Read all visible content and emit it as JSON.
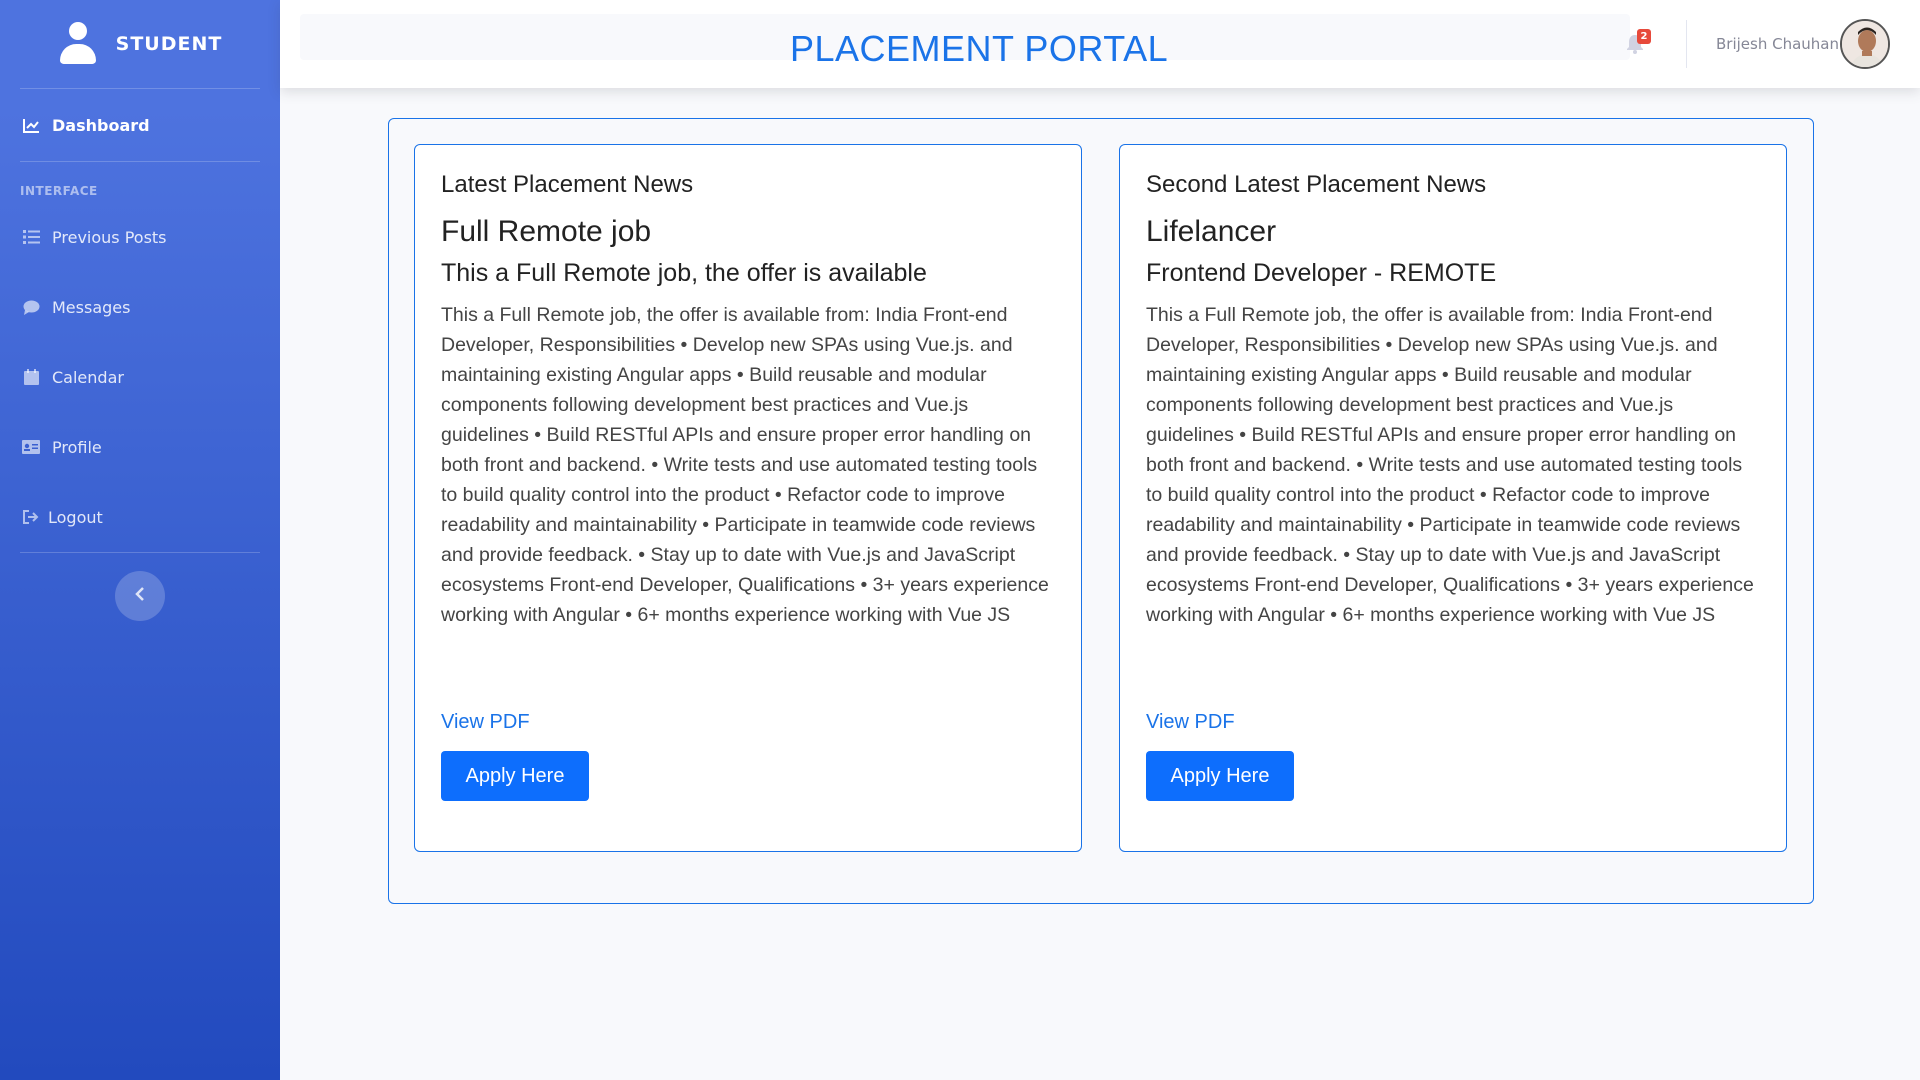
{
  "sidebar": {
    "brand": "STUDENT",
    "heading": "INTERFACE",
    "items": [
      {
        "label": "Dashboard",
        "icon": "chart-line-icon"
      },
      {
        "label": "Previous Posts",
        "icon": "list-icon"
      },
      {
        "label": "Messages",
        "icon": "comment-icon"
      },
      {
        "label": "Calendar",
        "icon": "calendar-icon"
      },
      {
        "label": "Profile",
        "icon": "id-card-icon"
      },
      {
        "label": "Logout",
        "icon": "sign-out-icon"
      }
    ]
  },
  "topbar": {
    "title": "PLACEMENT PORTAL",
    "notification_count": "2",
    "user_name": "Brijesh Chauhan"
  },
  "cards": [
    {
      "section_title": "Latest Placement News",
      "job_title": "Full Remote job",
      "job_subtitle": "This a Full Remote job, the offer is available",
      "description": "This a Full Remote job, the offer is available from: India Front-end Developer, Responsibilities • Develop new SPAs using Vue.js. and maintaining existing Angular apps • Build reusable and modular components following development best practices and Vue.js guidelines • Build RESTful APIs and ensure proper error handling on both front and backend. • Write tests and use automated testing tools to build quality control into the product • Refactor code to improve readability and maintainability • Participate in teamwide code reviews and provide feedback. • Stay up to date with Vue.js and JavaScript ecosystems Front-end Developer, Qualifications • 3+ years experience working with Angular • 6+ months experience working with Vue JS",
      "pdf_link": "View PDF",
      "apply_label": "Apply Here"
    },
    {
      "section_title": "Second Latest Placement News",
      "job_title": "Lifelancer",
      "job_subtitle": "Frontend Developer - REMOTE",
      "description": "This a Full Remote job, the offer is available from: India Front-end Developer, Responsibilities • Develop new SPAs using Vue.js. and maintaining existing Angular apps • Build reusable and modular components following development best practices and Vue.js guidelines • Build RESTful APIs and ensure proper error handling on both front and backend. • Write tests and use automated testing tools to build quality control into the product • Refactor code to improve readability and maintainability • Participate in teamwide code reviews and provide feedback. • Stay up to date with Vue.js and JavaScript ecosystems Front-end Developer, Qualifications • 3+ years experience working with Angular • 6+ months experience working with Vue JS",
      "pdf_link": "View PDF",
      "apply_label": "Apply Here"
    }
  ],
  "colors": {
    "sidebar_top": "#4e73df",
    "sidebar_bottom": "#224abe",
    "accent": "#1a73e8",
    "button": "#0d6efd",
    "badge": "#e74a3b"
  }
}
